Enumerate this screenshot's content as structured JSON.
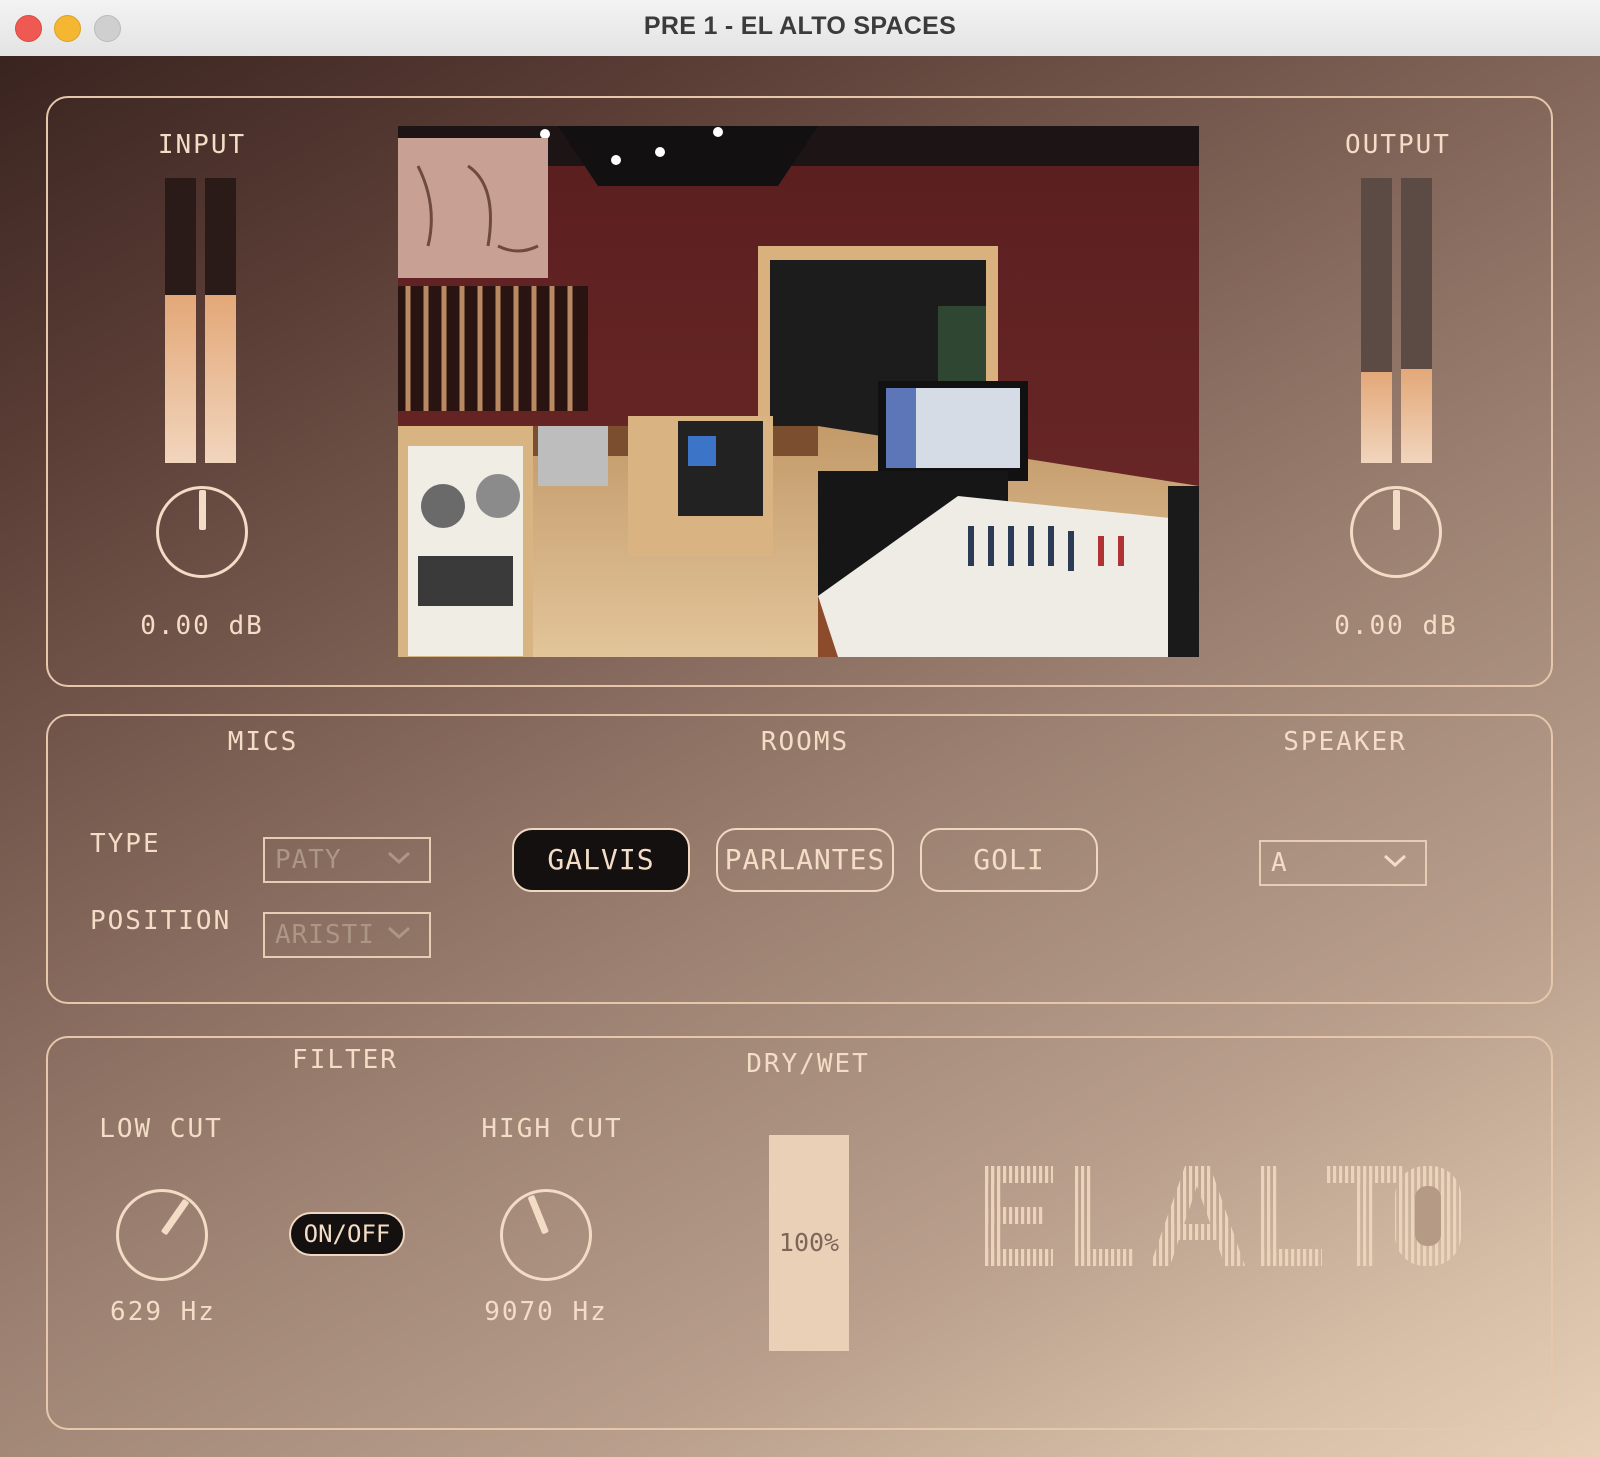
{
  "window": {
    "title": "PRE 1 - EL ALTO SPACES"
  },
  "input": {
    "label": "INPUT",
    "value": "0.00 dB",
    "meter_levels": [
      0.59,
      0.59
    ],
    "knob_level": 0.5
  },
  "output": {
    "label": "OUTPUT",
    "value": "0.00 dB",
    "meter_levels": [
      0.32,
      0.33
    ],
    "knob_level": 0.5
  },
  "mics": {
    "label": "MICS",
    "type_label": "TYPE",
    "type_value": "PATY",
    "position_label": "POSITION",
    "position_value": "ARISTI"
  },
  "rooms": {
    "label": "ROOMS",
    "options": [
      "GALVIS",
      "PARLANTES",
      "GOLI"
    ],
    "selected": "GALVIS"
  },
  "speaker": {
    "label": "SPEAKER",
    "value": "A"
  },
  "filter": {
    "label": "FILTER",
    "low_cut_label": "LOW CUT",
    "low_cut_value": "629 Hz",
    "high_cut_label": "HIGH CUT",
    "high_cut_value": "9070 Hz",
    "onoff_label": "ON/OFF"
  },
  "drywet": {
    "label": "DRY/WET",
    "value": "100%"
  },
  "logo": {
    "text": "EL ALTO"
  },
  "colors": {
    "accent": "#f3ddc6",
    "meter_fill": "#e3a878",
    "button_active": "#141010"
  }
}
